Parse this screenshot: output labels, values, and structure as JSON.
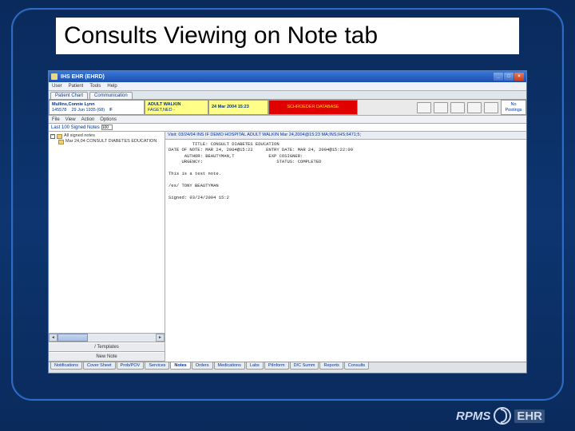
{
  "slide": {
    "title": "Consults Viewing on Note tab"
  },
  "window": {
    "title": "IHS EHR (EHRD)",
    "menus": [
      "User",
      "Patient",
      "Tools",
      "Help"
    ],
    "top_tabs": [
      "Patient Chart",
      "Communication"
    ],
    "min": "_",
    "max": "□",
    "close": "×"
  },
  "info": {
    "patient_name": "Mullins,Connie Lynn",
    "patient_id": "145578",
    "patient_dob": "29 Jun 1935 (68)",
    "patient_sex": "F",
    "walkin_l1": "ADULT WALKIN",
    "walkin_l2": "FAGET,NED -",
    "date": "24 Mar 2004 15:23",
    "db_label": "SCHROEDER DATABASE",
    "postings_l1": "No",
    "postings_l2": "Postings"
  },
  "submenu": [
    "File",
    "View",
    "Action",
    "Options"
  ],
  "lastnotes": {
    "label": "Last 100 Signed Notes",
    "value": "100"
  },
  "tree": {
    "root": "All signed notes",
    "child": "Mar 24,04 CONSULT DIABETES EDUCATION"
  },
  "tree_buttons": [
    "/ Templates",
    "New Note"
  ],
  "note": {
    "header": "Visit: 03/24/04  INS IF DEMO HOSPITAL  ADULT WALKIN  Mar 24,2004@15:23  MA;INS;IHS;6471;5;",
    "body": "         TITLE: CONSULT DIABETES EDUCATION\nDATE OF NOTE: MAR 24, 2004@15:22     ENTRY DATE: MAR 24, 2004@15:22:09\n      AUTHOR: BEAUTYMAN,T             EXP COSIGNER:\n     URGENCY:                            STATUS: COMPLETED\n\nThis is a test note.\n\n/es/ TONY BEAUTYMAN\n\nSigned: 03/24/2004 15:2"
  },
  "bottom_tabs": [
    "Notifications",
    "Cover Sheet",
    "Prob/POV",
    "Services",
    "Notes",
    "Orders",
    "Medications",
    "Labs",
    "PtInform",
    "D/C Summ",
    "Reports",
    "Consults"
  ],
  "active_bottom_tab": "Notes",
  "logo": {
    "brand1": "RPMS",
    "brand2": "EHR"
  }
}
